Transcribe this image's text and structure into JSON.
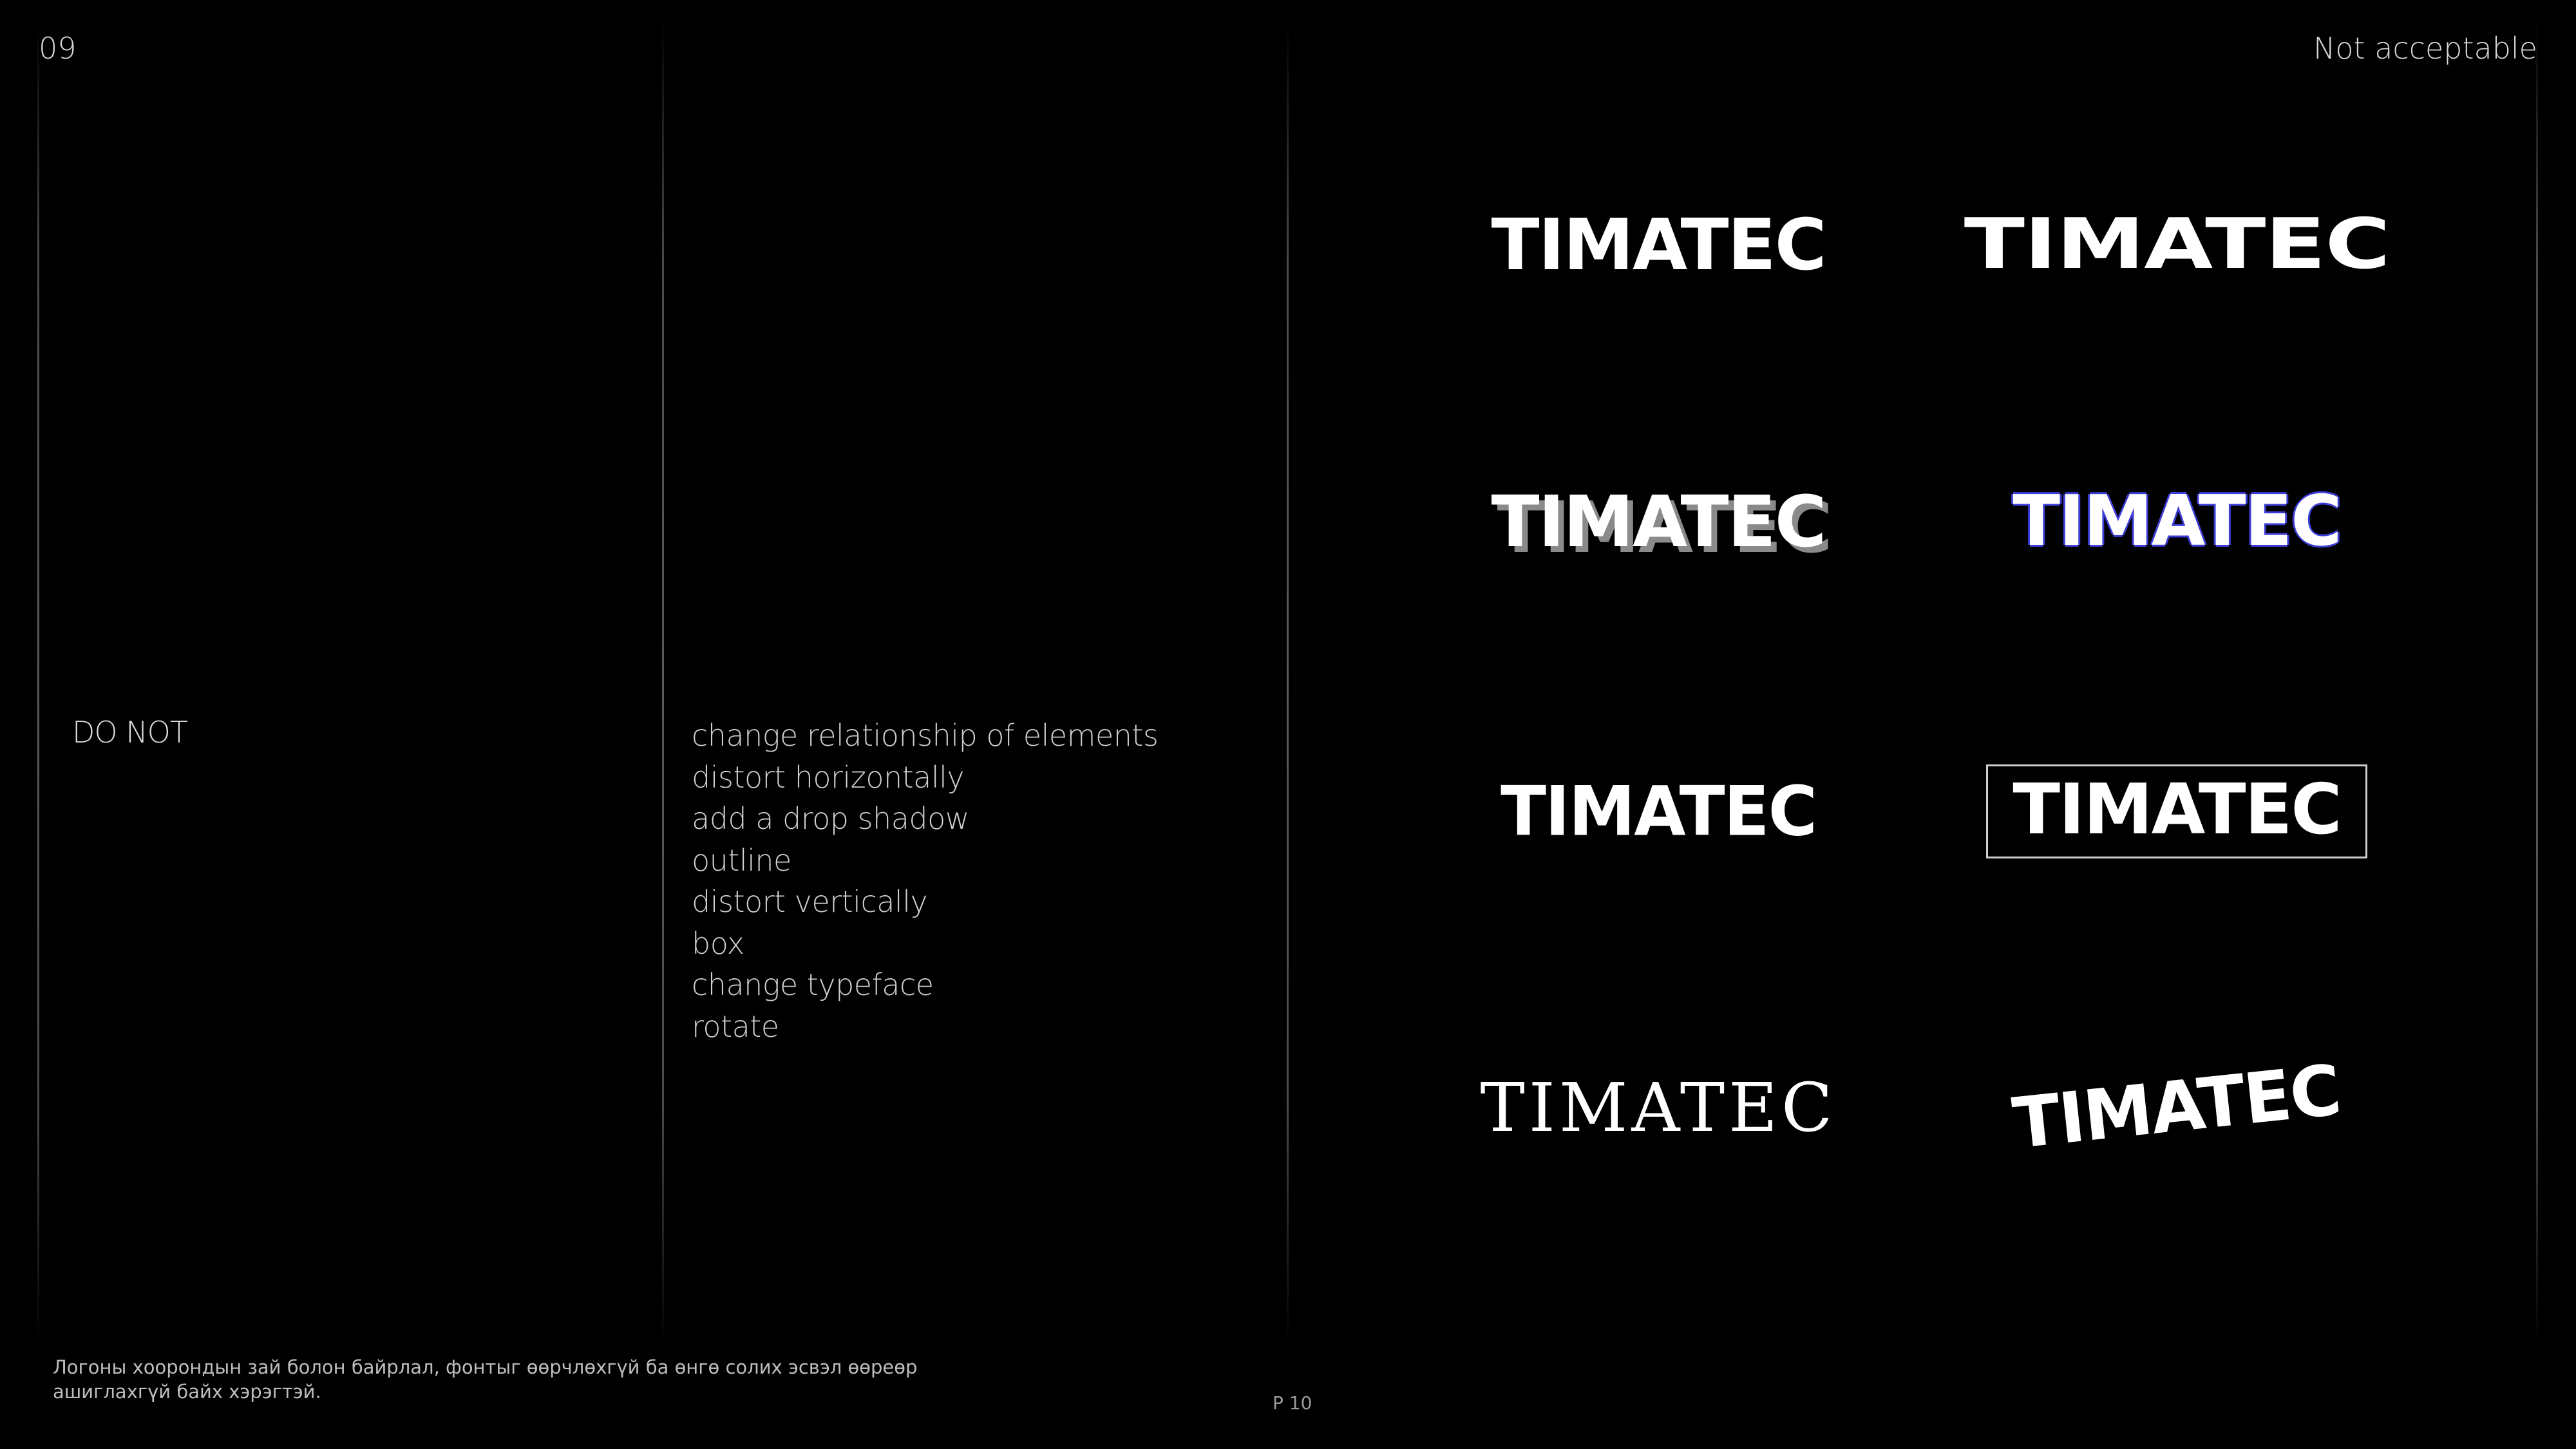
{
  "header": {
    "page_number": "09",
    "section_label": "Not acceptable"
  },
  "intro": {
    "label": "DO NOT"
  },
  "rules": [
    "change relationship of elements",
    "distort horizontally",
    "add a drop shadow",
    "outline",
    "distort vertically",
    "box",
    "change typeface",
    "rotate"
  ],
  "logos": {
    "wordmark": "TIMATEC",
    "outline_color": "#3d3dd8",
    "shadow_color": "#8a8a8a"
  },
  "footer": {
    "note": "Логоны хоорондын зай болон байрлал, фонтыг өөрчлөхгүй ба өнгө солих эсвэл өөреөр ашиглахгүй байх хэрэгтэй.",
    "page_ref": "P 10"
  }
}
